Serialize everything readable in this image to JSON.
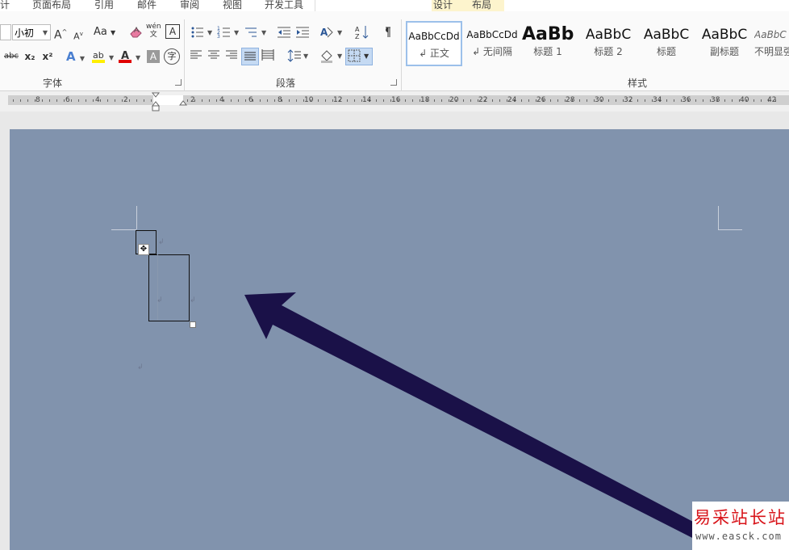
{
  "tabs": {
    "items": [
      "计",
      "页面布局",
      "引用",
      "邮件",
      "审阅",
      "视图",
      "开发工具"
    ],
    "context_items": [
      "设计",
      "布局"
    ]
  },
  "font_group": {
    "label": "字体",
    "font_name": "",
    "font_size": "小初",
    "grow_label": "A",
    "shrink_label": "A",
    "case_label": "Aa",
    "strike_label": "abc",
    "sub_label": "x₂",
    "sup_label": "x²",
    "text_effect_label": "A",
    "font_color_label": "A",
    "shade_label": "A",
    "char_border_label": "A",
    "phonetic_label": "wén",
    "enclose_label": "字"
  },
  "paragraph_group": {
    "label": "段落"
  },
  "styles_group": {
    "label": "样式",
    "items": [
      {
        "preview": "AaBbCcDd",
        "name": "↲ 正文"
      },
      {
        "preview": "AaBbCcDd",
        "name": "↲ 无间隔"
      },
      {
        "preview": "AaBb",
        "name": "标题 1"
      },
      {
        "preview": "AaBbC",
        "name": "标题 2"
      },
      {
        "preview": "AaBbC",
        "name": "标题"
      },
      {
        "preview": "AaBbC",
        "name": "副标题"
      },
      {
        "preview": "AaBbC",
        "name": "不明显强"
      }
    ]
  },
  "ruler": {
    "left_numbers": [
      "8",
      "6",
      "4",
      "2"
    ],
    "right_numbers": [
      "2",
      "4",
      "6",
      "8",
      "10",
      "12",
      "14",
      "16",
      "18",
      "20",
      "22",
      "24",
      "26",
      "28",
      "30",
      "32",
      "34",
      "36",
      "38",
      "40",
      "42"
    ]
  },
  "document": {
    "paragraph_mark": "↲",
    "move_handle": "✥"
  },
  "watermark": {
    "title": "易采站长站",
    "url": "www.easck.com"
  },
  "colors": {
    "page_background": "#8193ad",
    "arrow": "#1a1148",
    "highlight_yellow": "#ffef00",
    "font_red": "#e00000",
    "watermark_red": "#d8141a"
  }
}
